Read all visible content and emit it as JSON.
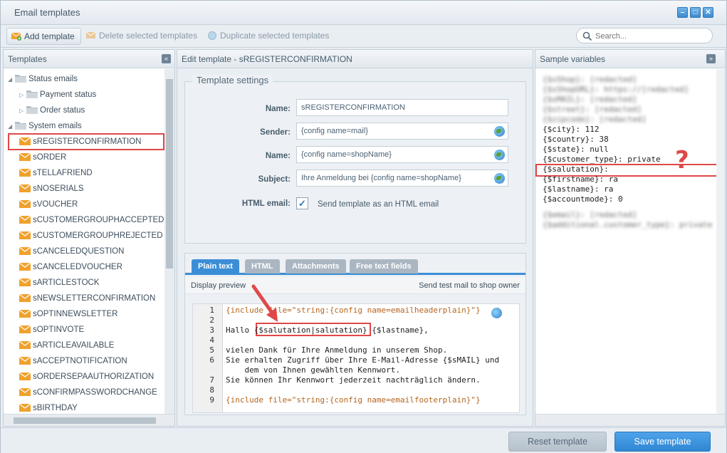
{
  "window": {
    "title": "Email templates"
  },
  "toolbar": {
    "add_label": "Add template",
    "delete_label": "Delete selected templates",
    "duplicate_label": "Duplicate selected templates",
    "search_placeholder": "Search..."
  },
  "left_panel": {
    "title": "Templates",
    "tree": [
      {
        "label": "Status emails",
        "type": "folder",
        "level": 0,
        "expanded": true
      },
      {
        "label": "Payment status",
        "type": "folder",
        "level": 1,
        "expanded": false
      },
      {
        "label": "Order status",
        "type": "folder",
        "level": 1,
        "expanded": false
      },
      {
        "label": "System emails",
        "type": "folder",
        "level": 0,
        "expanded": true
      },
      {
        "label": "sREGISTERCONFIRMATION",
        "type": "mail",
        "level": 1,
        "selected": true
      },
      {
        "label": "sORDER",
        "type": "mail",
        "level": 1
      },
      {
        "label": "sTELLAFRIEND",
        "type": "mail",
        "level": 1
      },
      {
        "label": "sNOSERIALS",
        "type": "mail",
        "level": 1
      },
      {
        "label": "sVOUCHER",
        "type": "mail",
        "level": 1
      },
      {
        "label": "sCUSTOMERGROUPHACCEPTED",
        "type": "mail",
        "level": 1
      },
      {
        "label": "sCUSTOMERGROUPHREJECTED",
        "type": "mail",
        "level": 1
      },
      {
        "label": "sCANCELEDQUESTION",
        "type": "mail",
        "level": 1
      },
      {
        "label": "sCANCELEDVOUCHER",
        "type": "mail",
        "level": 1
      },
      {
        "label": "sARTICLESTOCK",
        "type": "mail",
        "level": 1
      },
      {
        "label": "sNEWSLETTERCONFIRMATION",
        "type": "mail",
        "level": 1
      },
      {
        "label": "sOPTINNEWSLETTER",
        "type": "mail",
        "level": 1
      },
      {
        "label": "sOPTINVOTE",
        "type": "mail",
        "level": 1
      },
      {
        "label": "sARTICLEAVAILABLE",
        "type": "mail",
        "level": 1
      },
      {
        "label": "sACCEPTNOTIFICATION",
        "type": "mail",
        "level": 1
      },
      {
        "label": "sORDERSEPAAUTHORIZATION",
        "type": "mail",
        "level": 1
      },
      {
        "label": "sCONFIRMPASSWORDCHANGE",
        "type": "mail",
        "level": 1
      },
      {
        "label": "sBIRTHDAY",
        "type": "mail",
        "level": 1
      }
    ]
  },
  "center_panel": {
    "title": "Edit template - sREGISTERCONFIRMATION",
    "settings_legend": "Template settings",
    "fields": {
      "name_label": "Name:",
      "name_value": "sREGISTERCONFIRMATION",
      "sender_label": "Sender:",
      "sender_value": "{config name=mail}",
      "fromname_label": "Name:",
      "fromname_value": "{config name=shopName}",
      "subject_label": "Subject:",
      "subject_value": "Ihre Anmeldung bei {config name=shopName}",
      "html_label": "HTML email:",
      "html_checked": true,
      "html_text": "Send template as an HTML email"
    },
    "tabs": [
      "Plain text",
      "HTML",
      "Attachments",
      "Free text fields"
    ],
    "display_preview": "Display preview",
    "send_test": "Send test mail to shop owner",
    "code_lines": [
      {
        "n": "1",
        "t": "{include file=\"string:{config name=emailheaderplain}\"}"
      },
      {
        "n": "2",
        "t": ""
      },
      {
        "n": "3",
        "t": "Hallo {$salutation|salutation} {$lastname},"
      },
      {
        "n": "4",
        "t": ""
      },
      {
        "n": "5",
        "t": "vielen Dank für Ihre Anmeldung in unserem Shop."
      },
      {
        "n": "6",
        "t": "Sie erhalten Zugriff über Ihre E-Mail-Adresse {$sMAIL} und"
      },
      {
        "n": "",
        "t": "    dem von Ihnen gewählten Kennwort."
      },
      {
        "n": "7",
        "t": "Sie können Ihr Kennwort jederzeit nachträglich ändern."
      },
      {
        "n": "8",
        "t": ""
      },
      {
        "n": "9",
        "t": "{include file=\"string:{config name=emailfooterplain}\"}"
      }
    ]
  },
  "right_panel": {
    "title": "Sample variables",
    "lines": [
      {
        "t": "{$city}: 112",
        "blur": false
      },
      {
        "t": "{$country}: 38",
        "blur": false
      },
      {
        "t": "{$state}: null",
        "blur": false
      },
      {
        "t": "{$customer_type}: private",
        "blur": false
      },
      {
        "t": "{$salutation}:",
        "blur": false
      },
      {
        "t": "{$firstname}: ra",
        "blur": false
      },
      {
        "t": "{$lastname}: ra",
        "blur": false
      },
      {
        "t": "{$accountmode}: 0",
        "blur": false
      }
    ],
    "annotation": "?"
  },
  "footer": {
    "reset_label": "Reset template",
    "save_label": "Save template"
  },
  "colors": {
    "accent": "#3b8ed6",
    "highlight": "#e04848",
    "folder": "#b4bfc9",
    "mail": "#f0a12c"
  }
}
